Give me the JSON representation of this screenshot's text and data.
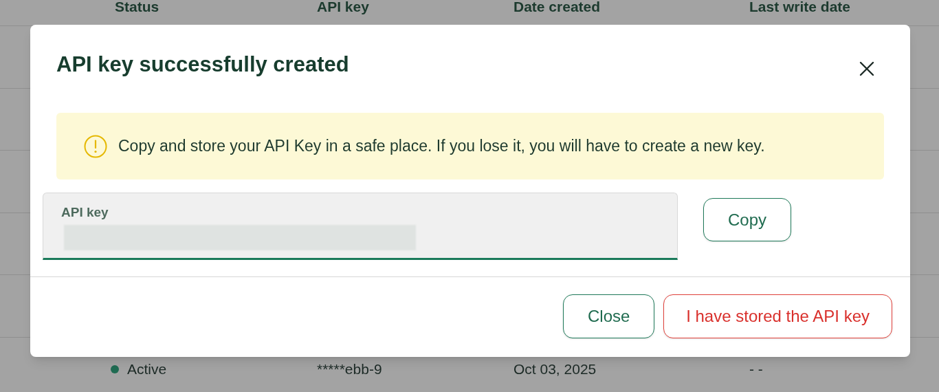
{
  "table": {
    "columns": [
      "Status",
      "API key",
      "Date created",
      "Last write date"
    ],
    "rows": [
      {
        "status": "Active",
        "color": "#1f6b52",
        "api_key": "*****ebb-9",
        "date_created": "Oct 03, 2025",
        "last_write_date": "- -"
      }
    ]
  },
  "dialog": {
    "title": "API key successfully created",
    "notice": "Copy and store your API Key in a safe place. If you lose it, you will have to create a new key.",
    "field": {
      "label": "API key",
      "value_redacted": true,
      "focused": true
    },
    "copy_button": "Copy",
    "buttons": [
      {
        "label": "Close",
        "kind": "secondary"
      },
      {
        "label": "I have stored the API key",
        "kind": "danger"
      }
    ]
  }
}
